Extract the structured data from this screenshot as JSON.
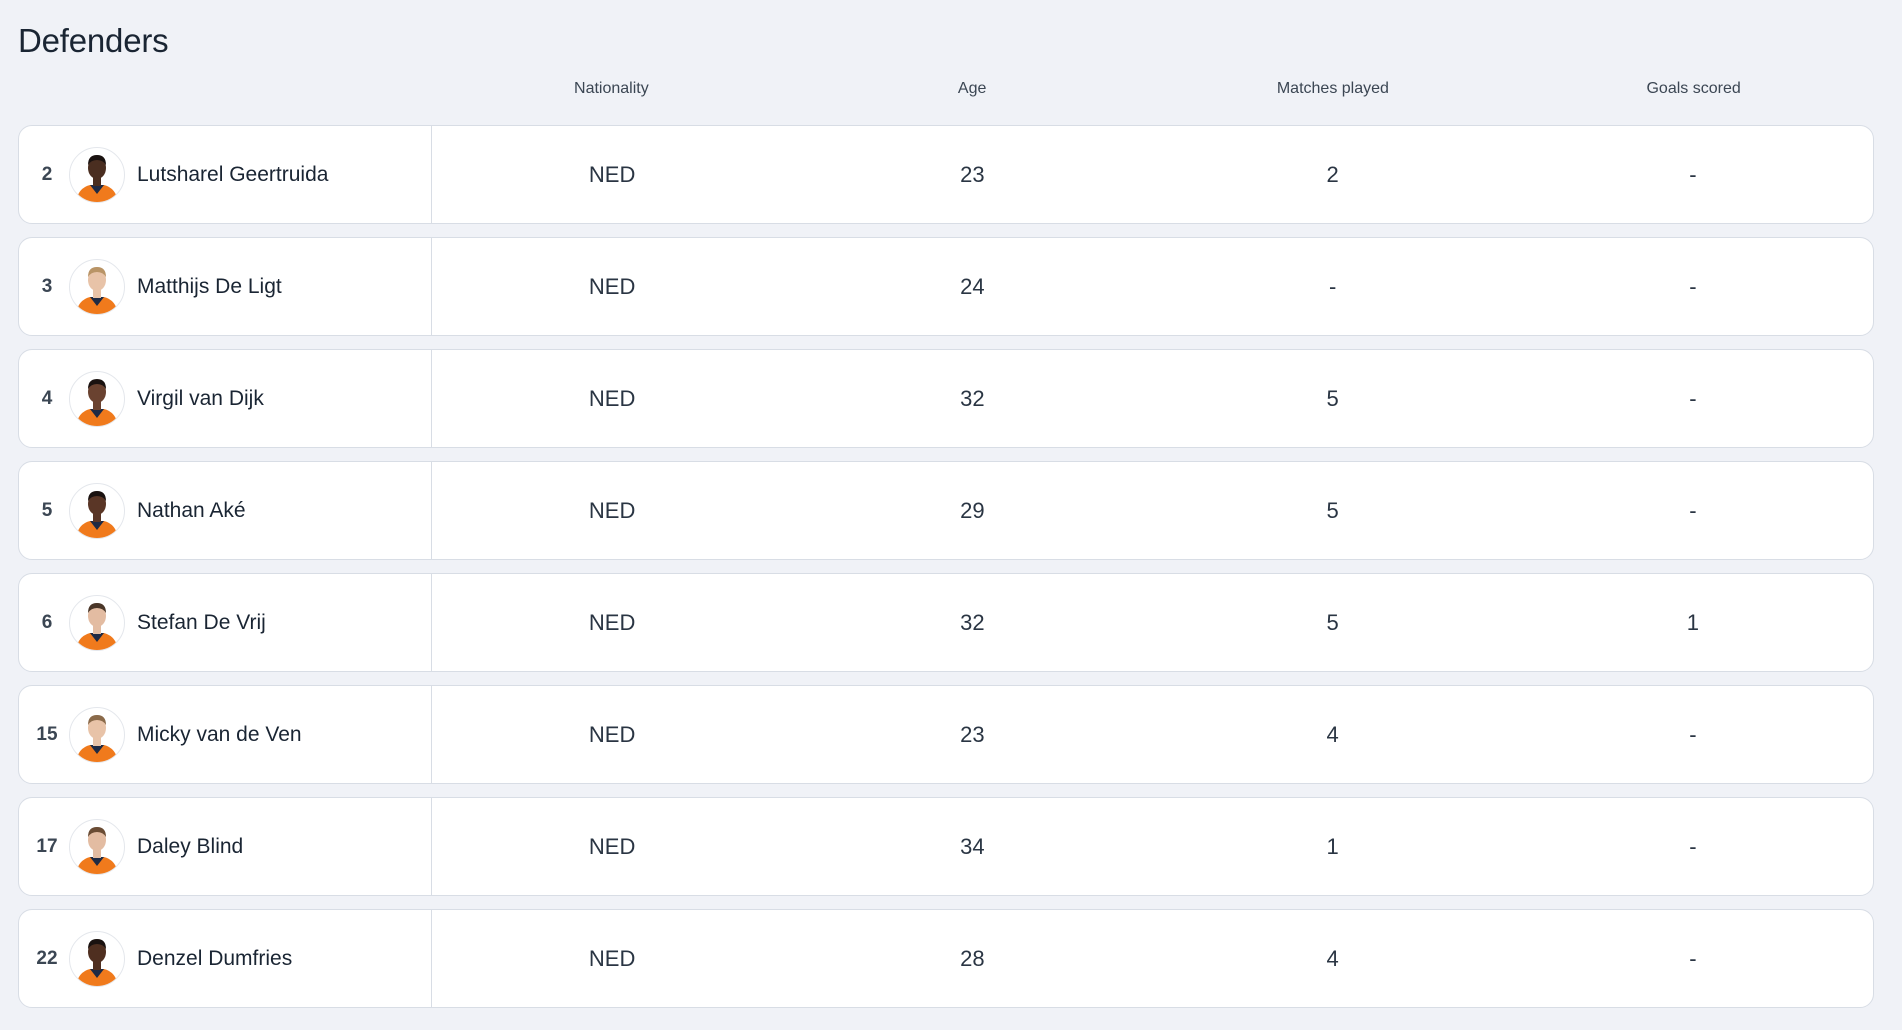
{
  "section": {
    "title": "Defenders"
  },
  "columns": {
    "nationality": "Nationality",
    "age": "Age",
    "matches_played": "Matches played",
    "goals_scored": "Goals scored"
  },
  "players": [
    {
      "number": "2",
      "name": "Lutsharel Geertruida",
      "nationality": "NED",
      "age": "23",
      "matches_played": "2",
      "goals_scored": "-",
      "skin": "#4a2e20",
      "hair": "#1a1210"
    },
    {
      "number": "3",
      "name": "Matthijs De Ligt",
      "nationality": "NED",
      "age": "24",
      "matches_played": "-",
      "goals_scored": "-",
      "skin": "#e8c3a8",
      "hair": "#b99466"
    },
    {
      "number": "4",
      "name": "Virgil van Dijk",
      "nationality": "NED",
      "age": "32",
      "matches_played": "5",
      "goals_scored": "-",
      "skin": "#6a4230",
      "hair": "#1a1210"
    },
    {
      "number": "5",
      "name": "Nathan Aké",
      "nationality": "NED",
      "age": "29",
      "matches_played": "5",
      "goals_scored": "-",
      "skin": "#5a3626",
      "hair": "#1a1210"
    },
    {
      "number": "6",
      "name": "Stefan De Vrij",
      "nationality": "NED",
      "age": "32",
      "matches_played": "5",
      "goals_scored": "1",
      "skin": "#e3bca2",
      "hair": "#4a3628"
    },
    {
      "number": "15",
      "name": "Micky van de Ven",
      "nationality": "NED",
      "age": "23",
      "matches_played": "4",
      "goals_scored": "-",
      "skin": "#e8c3a8",
      "hair": "#8a6a4a"
    },
    {
      "number": "17",
      "name": "Daley Blind",
      "nationality": "NED",
      "age": "34",
      "matches_played": "1",
      "goals_scored": "-",
      "skin": "#e3bca2",
      "hair": "#6a4c34"
    },
    {
      "number": "22",
      "name": "Denzel Dumfries",
      "nationality": "NED",
      "age": "28",
      "matches_played": "4",
      "goals_scored": "-",
      "skin": "#4f2f20",
      "hair": "#1a1210"
    }
  ],
  "colors": {
    "background": "#f0f2f7",
    "row_background": "#ffffff",
    "border": "#d8dde5",
    "shirt_orange": "#f07a1c",
    "shirt_navy": "#1e2a44"
  }
}
